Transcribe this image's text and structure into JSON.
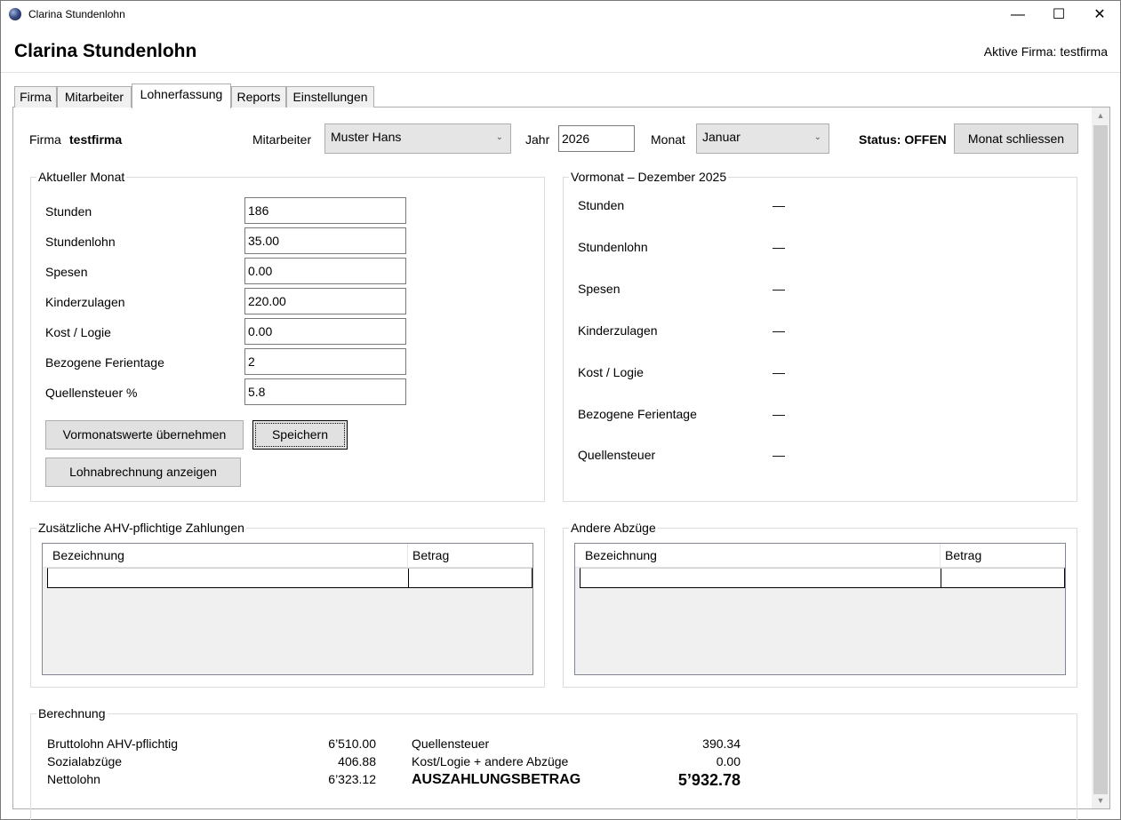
{
  "window": {
    "title": "Clarina Stundenlohn",
    "controls": {
      "minimize": "—",
      "maximize": "☐",
      "close": "✕"
    }
  },
  "header": {
    "title": "Clarina Stundenlohn",
    "active_company": "Aktive Firma: testfirma"
  },
  "tabs": [
    {
      "label": "Firma"
    },
    {
      "label": "Mitarbeiter"
    },
    {
      "label": "Lohnerfassung"
    },
    {
      "label": "Reports"
    },
    {
      "label": "Einstellungen"
    }
  ],
  "toolbar": {
    "firma_label": "Firma",
    "firma_value": "testfirma",
    "mitarbeiter_label": "Mitarbeiter",
    "mitarbeiter_value": "Muster Hans",
    "jahr_label": "Jahr",
    "jahr_value": "2026",
    "monat_label": "Monat",
    "monat_value": "Januar",
    "status": "Status: OFFEN",
    "close_month_button": "Monat schliessen"
  },
  "current_month": {
    "title": "Aktueller Monat",
    "fields": [
      {
        "label": "Stunden",
        "value": "186"
      },
      {
        "label": "Stundenlohn",
        "value": "35.00"
      },
      {
        "label": "Spesen",
        "value": "0.00"
      },
      {
        "label": "Kinderzulagen",
        "value": "220.00"
      },
      {
        "label": "Kost / Logie",
        "value": "0.00"
      },
      {
        "label": "Bezogene Ferientage",
        "value": "2"
      },
      {
        "label": "Quellensteuer %",
        "value": "5.8"
      }
    ],
    "buttons": {
      "copy_previous": "Vormonatswerte übernehmen",
      "save": "Speichern",
      "show_payslip": "Lohnabrechnung anzeigen"
    }
  },
  "previous_month": {
    "title": "Vormonat – Dezember 2025",
    "fields": [
      {
        "label": "Stunden",
        "value": "—"
      },
      {
        "label": "Stundenlohn",
        "value": "—"
      },
      {
        "label": "Spesen",
        "value": "—"
      },
      {
        "label": "Kinderzulagen",
        "value": "—"
      },
      {
        "label": "Kost / Logie",
        "value": "—"
      },
      {
        "label": "Bezogene Ferientage",
        "value": "—"
      },
      {
        "label": "Quellensteuer",
        "value": "—"
      }
    ]
  },
  "ahv_payments": {
    "title": "Zusätzliche AHV-pflichtige Zahlungen",
    "columns": [
      "Bezeichnung",
      "Betrag"
    ]
  },
  "other_deductions": {
    "title": "Andere Abzüge",
    "columns": [
      "Bezeichnung",
      "Betrag"
    ]
  },
  "calculation": {
    "title": "Berechnung",
    "left": [
      {
        "label": "Bruttolohn AHV-pflichtig",
        "value": "6’510.00"
      },
      {
        "label": "Sozialabzüge",
        "value": "406.88"
      },
      {
        "label": "Nettolohn",
        "value": "6’323.12"
      }
    ],
    "right": [
      {
        "label": "Quellensteuer",
        "value": "390.34"
      },
      {
        "label": "Kost/Logie + andere Abzüge",
        "value": "0.00"
      }
    ],
    "payout_label": "AUSZAHLUNGSBETRAG",
    "payout_value": "5’932.78"
  },
  "icons": {
    "combo_arrow": "⌄",
    "scroll_up": "▲",
    "scroll_down": "▼"
  }
}
